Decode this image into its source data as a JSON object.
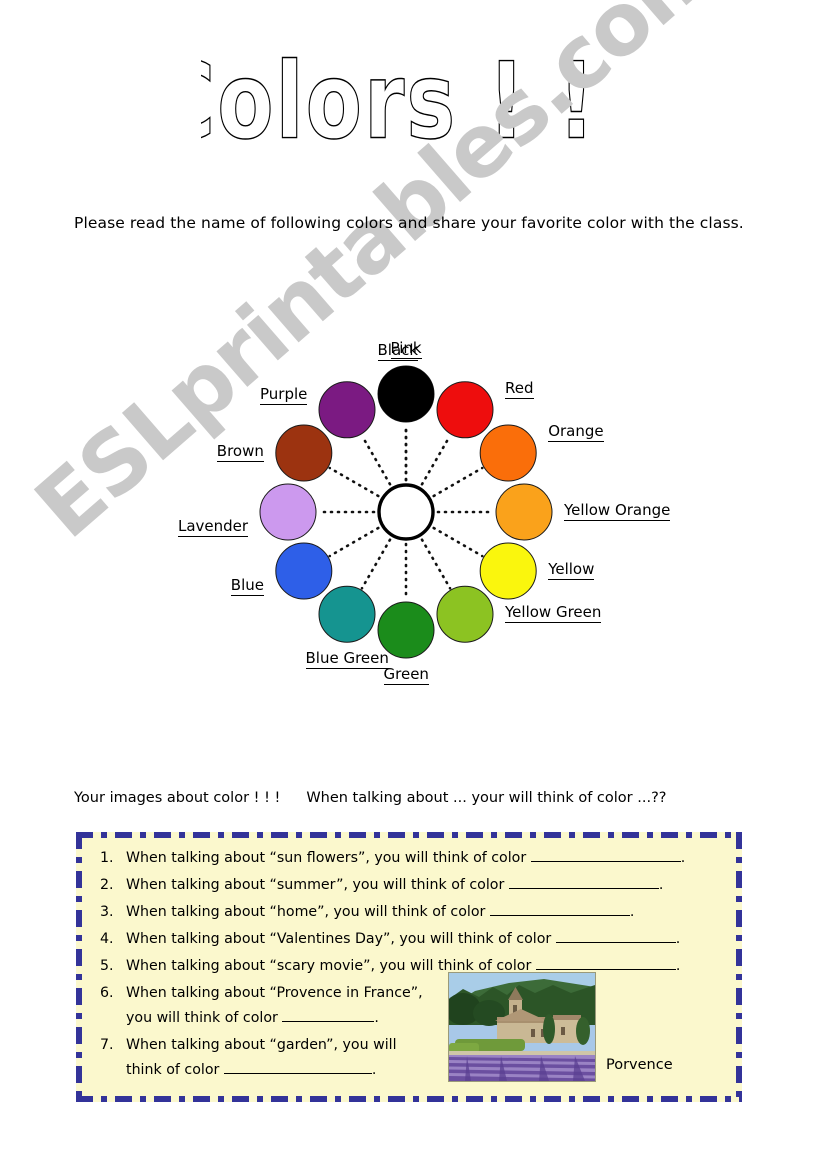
{
  "watermark": "ESLprintables.com",
  "title": "Colors ! ! !",
  "intro": "Please read the name of following colors and share your favorite color with the class.",
  "wheel": {
    "hub_label": "center-hub",
    "circles": [
      {
        "label": "Pink",
        "color": "#ee00dd",
        "angle": -90,
        "label_pos": "top"
      },
      {
        "label": "Red",
        "color": "#ee0d0d",
        "angle": -60,
        "label_pos": "right"
      },
      {
        "label": "Orange",
        "color": "#fa6e0a",
        "angle": -30,
        "label_pos": "right"
      },
      {
        "label": "Yellow Orange",
        "color": "#faa21b",
        "angle": 0,
        "label_pos": "right"
      },
      {
        "label": "Yellow",
        "color": "#faf60d",
        "angle": 30,
        "label_pos": "right"
      },
      {
        "label": "Yellow Green",
        "color": "#8cc322",
        "angle": 60,
        "label_pos": "right"
      },
      {
        "label": "Green",
        "color": "#1b8c1b",
        "angle": 90,
        "label_pos": "bottom"
      },
      {
        "label": "Blue Green",
        "color": "#159490",
        "angle": 120,
        "label_pos": "bottom"
      },
      {
        "label": "Blue",
        "color": "#2e5fe8",
        "angle": 150,
        "label_pos": "left"
      },
      {
        "label": "Lavender",
        "color": "#cc99ee",
        "angle": 180,
        "label_pos": "left"
      },
      {
        "label": "Brown",
        "color": "#9c3310",
        "angle": 210,
        "label_pos": "left"
      },
      {
        "label": "Purple",
        "color": "#7b1a82",
        "angle": 240,
        "label_pos": "left"
      },
      {
        "label": "Black",
        "color": "#000000",
        "angle": 270,
        "label_pos": "top"
      }
    ]
  },
  "prompt": {
    "left": "Your images about color ! ! !",
    "right": "When talking about ... your will think of color ...??"
  },
  "questions": [
    {
      "num": "1.",
      "text_before": "When talking about “sun flowers”, you will think of color",
      "blank_width": 150,
      "text_after": "."
    },
    {
      "num": "2.",
      "text_before": "When talking about “summer”, you will think of color",
      "blank_width": 150,
      "text_after": "."
    },
    {
      "num": "3.",
      "text_before": "When talking about “home”, you will think of color",
      "blank_width": 140,
      "text_after": "."
    },
    {
      "num": "4.",
      "text_before": "When talking about “Valentines Day”, you will think of color",
      "blank_width": 120,
      "text_after": "."
    },
    {
      "num": "5.",
      "text_before": "When talking about “scary movie”, you will think of color",
      "blank_width": 140,
      "text_after": "."
    },
    {
      "num": "6.",
      "text_before": "When talking about “Provence in France”,",
      "line2_before": "you will think of color",
      "blank_width": 92,
      "text_after": "."
    },
    {
      "num": "7.",
      "text_before": "When talking about “garden”, you will",
      "line2_before": "think of color",
      "blank_width": 148,
      "text_after": "."
    }
  ],
  "photo": {
    "name": "provence-lavender-field-photo",
    "caption": "Porvence",
    "colors": {
      "sky": "#a9cde8",
      "hill": "#2f5a2a",
      "trees": "#244a22",
      "building": "#c9b894",
      "roof": "#a8906e",
      "hedge": "#6f9a3a",
      "lavender_row": "#6b4fa0",
      "lavender_light": "#9a83c4",
      "path": "#cfc6a8"
    }
  }
}
